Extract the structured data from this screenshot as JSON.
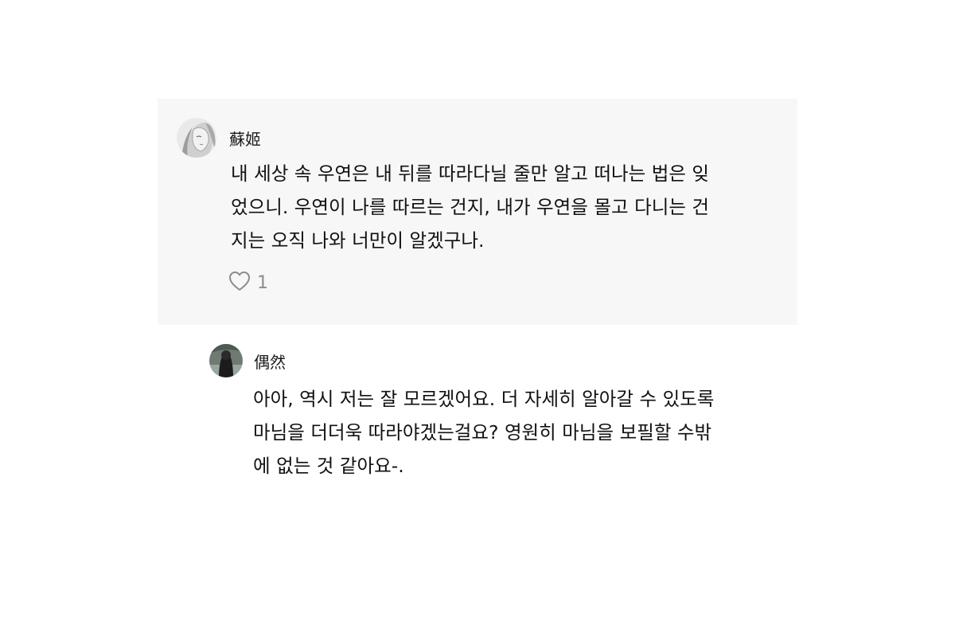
{
  "comment": {
    "author": "蘇姬",
    "lines": [
      "내 세상 속 우연은 내 뒤를 따라다닐 줄만 알고 떠나는 법은 잊",
      "었으니. 우연이 나를 따르는 건지, 내가 우연을 몰고 다니는 건",
      "지는 오직 나와 너만이 알겠구나."
    ],
    "like_icon": "heart-outline-icon",
    "like_count": "1"
  },
  "reply": {
    "author": "偶然",
    "lines": [
      "아아, 역시 저는 잘 모르겠어요. 더 자세히 알아갈 수 있도록",
      "마님을 더더욱 따라야겠는걸요? 영원히 마님을 보필할 수밖",
      "에 없는 것 같아요-."
    ]
  },
  "colors": {
    "card_background": "#f7f7f7",
    "text": "#111111",
    "muted": "#8c8c8c"
  }
}
